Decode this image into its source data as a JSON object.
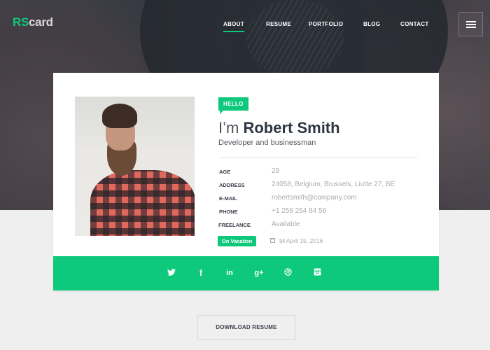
{
  "brand": {
    "logo_part1": "RS",
    "logo_part2": "card",
    "accent_color": "#0ec97b"
  },
  "nav": {
    "items": [
      {
        "label": "ABOUT",
        "active": true
      },
      {
        "label": "RESUME",
        "active": false
      },
      {
        "label": "PORTFOLIO",
        "active": false
      },
      {
        "label": "BLOG",
        "active": false
      },
      {
        "label": "CONTACT",
        "active": false
      }
    ],
    "menu_icon": "hamburger-icon"
  },
  "profile": {
    "badge": "HELLO",
    "greeting": "I’m",
    "name": "Robert Smith",
    "role": "Developer and businessman",
    "photo_alt": "Bearded man in red plaid shirt",
    "info": [
      {
        "key": "AGE",
        "value": "29"
      },
      {
        "key": "ADDRESS",
        "value": "24058, Belgium, Brussels, Liutte 27, BE"
      },
      {
        "key": "E-MAIL",
        "value": "robertsmith@company.com"
      },
      {
        "key": "PHONE",
        "value": "+1 256 254 84 56"
      },
      {
        "key": "FREELANCE",
        "value": "Available"
      }
    ],
    "status_badge": "On Vacation",
    "status_icon": "calendar-icon",
    "status_until": "till April 15, 2016"
  },
  "social": [
    {
      "name": "twitter",
      "glyph": "t"
    },
    {
      "name": "facebook",
      "glyph": "f"
    },
    {
      "name": "linkedin",
      "glyph": "in"
    },
    {
      "name": "google-plus",
      "glyph": "g+"
    },
    {
      "name": "dribbble",
      "glyph": "◎"
    },
    {
      "name": "instagram",
      "glyph": "◙"
    }
  ],
  "actions": {
    "download_label": "DOWNLOAD RESUME"
  }
}
